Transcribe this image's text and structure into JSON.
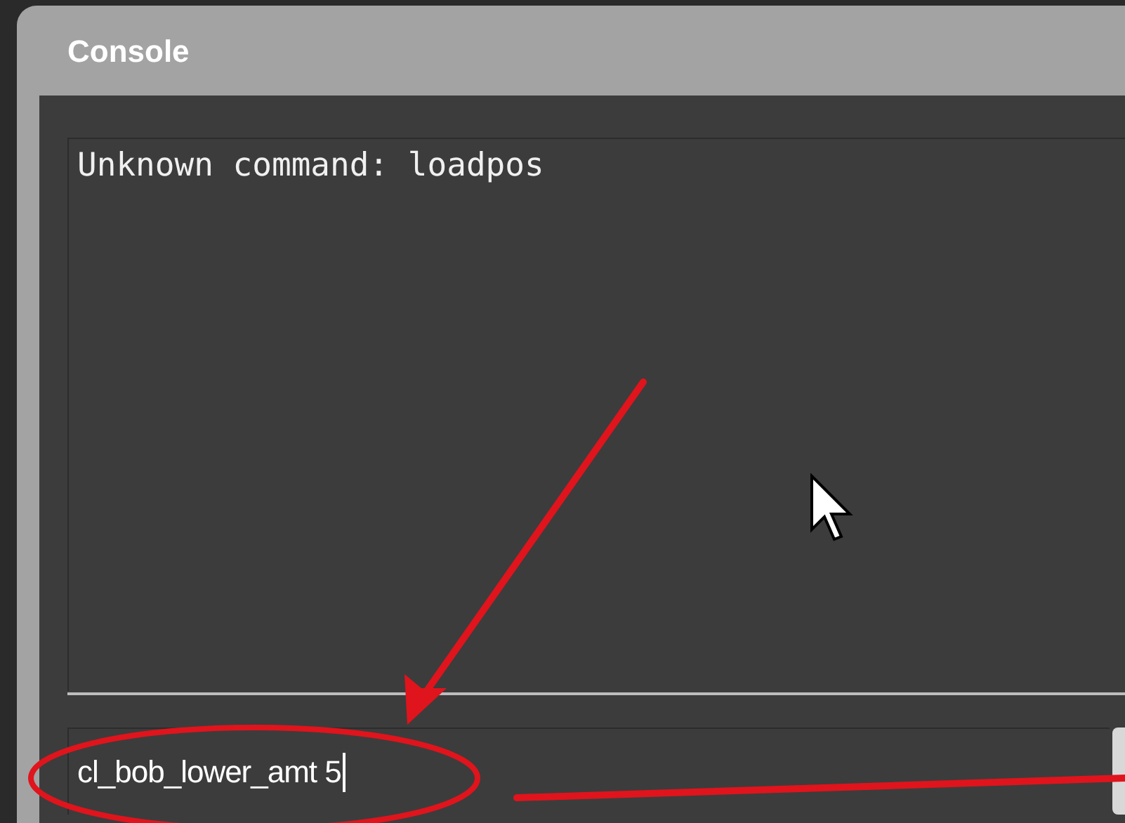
{
  "window": {
    "title": "Console"
  },
  "log": {
    "lines": [
      "Unknown command: loadpos"
    ]
  },
  "command_input": {
    "value": "cl_bob_lower_amt 5"
  }
}
